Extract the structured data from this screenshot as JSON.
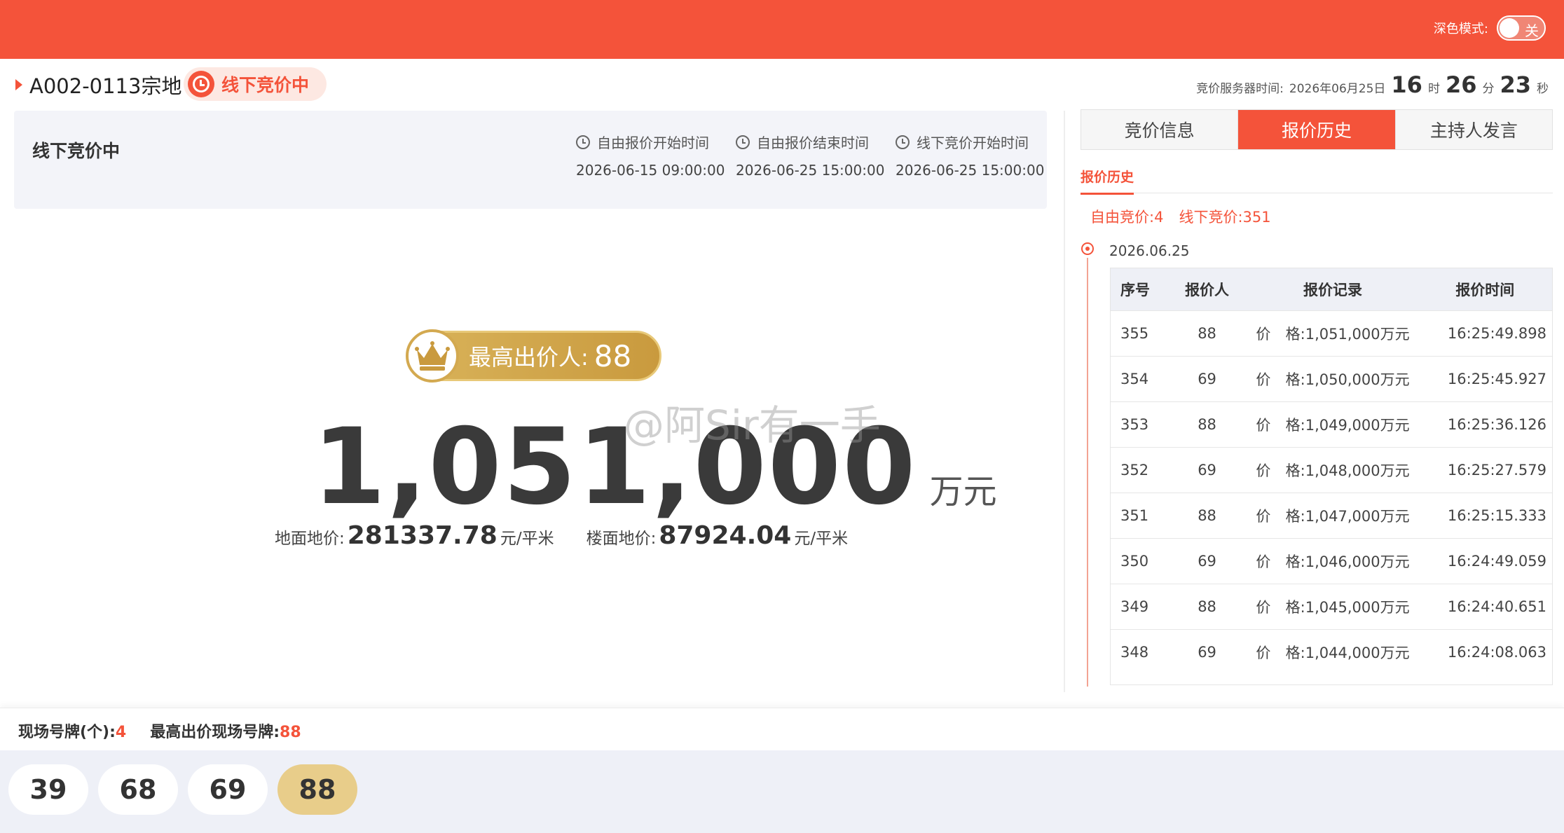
{
  "header": {
    "dark_mode_label": "深色模式:",
    "dark_mode_state": "关"
  },
  "lot": {
    "name": "A002-0113宗地",
    "status": "线下竞价中"
  },
  "server_time": {
    "label": "竞价服务器时间:",
    "date": "2026年06月25日",
    "hour": "16",
    "hour_unit": "时",
    "minute": "26",
    "minute_unit": "分",
    "second": "23",
    "second_unit": "秒"
  },
  "info_card": {
    "title": "线下竞价中",
    "times": [
      {
        "label": "自由报价开始时间",
        "value": "2026-06-15 09:00:00"
      },
      {
        "label": "自由报价结束时间",
        "value": "2026-06-25 15:00:00"
      },
      {
        "label": "线下竞价开始时间",
        "value": "2026-06-25 15:00:00"
      }
    ]
  },
  "highest": {
    "label": "最高出价人:",
    "bidder": "88"
  },
  "price": {
    "value": "1,051,000",
    "unit": "万元"
  },
  "unit_prices": {
    "land_label": "地面地价:",
    "land_value": "281337.78",
    "land_unit": "元/平米",
    "floor_label": "楼面地价:",
    "floor_value": "87924.04",
    "floor_unit": "元/平米"
  },
  "watermark": "@阿Sir有一手",
  "tabs": [
    "竞价信息",
    "报价历史",
    "主持人发言"
  ],
  "history": {
    "subtab": "报价历史",
    "free_label": "自由竞价:",
    "free_count": "4",
    "offline_label": "线下竞价:",
    "offline_count": "351",
    "date": "2026.06.25",
    "columns": [
      "序号",
      "报价人",
      "报价记录",
      "报价时间"
    ],
    "rows": [
      {
        "no": "355",
        "bidder": "88",
        "p1": "价",
        "p2": "格:1,051,000万元",
        "time": "16:25:49.898"
      },
      {
        "no": "354",
        "bidder": "69",
        "p1": "价",
        "p2": "格:1,050,000万元",
        "time": "16:25:45.927"
      },
      {
        "no": "353",
        "bidder": "88",
        "p1": "价",
        "p2": "格:1,049,000万元",
        "time": "16:25:36.126"
      },
      {
        "no": "352",
        "bidder": "69",
        "p1": "价",
        "p2": "格:1,048,000万元",
        "time": "16:25:27.579"
      },
      {
        "no": "351",
        "bidder": "88",
        "p1": "价",
        "p2": "格:1,047,000万元",
        "time": "16:25:15.333"
      },
      {
        "no": "350",
        "bidder": "69",
        "p1": "价",
        "p2": "格:1,046,000万元",
        "time": "16:24:49.059"
      },
      {
        "no": "349",
        "bidder": "88",
        "p1": "价",
        "p2": "格:1,045,000万元",
        "time": "16:24:40.651"
      },
      {
        "no": "348",
        "bidder": "69",
        "p1": "价",
        "p2": "格:1,044,000万元",
        "time": "16:24:08.063"
      }
    ]
  },
  "bottom": {
    "paddle_count_label": "现场号牌(个):",
    "paddle_count": "4",
    "highest_paddle_label": "最高出价现场号牌:",
    "highest_paddle": "88",
    "paddles": [
      "39",
      "68",
      "69",
      "88"
    ]
  },
  "colors": {
    "brand": "#f4533a",
    "gold": "#d9b35a",
    "winner_paddle": "#e8cd8a"
  }
}
